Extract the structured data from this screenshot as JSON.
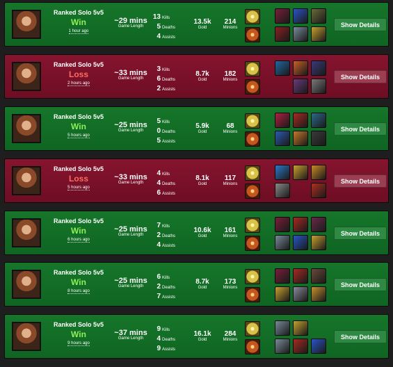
{
  "ui": {
    "kills_label": "Kills",
    "deaths_label": "Deaths",
    "assists_label": "Assists",
    "length_label": "Game Length",
    "gold_label": "Gold",
    "minions_label": "Minions",
    "button_label": "Show Details"
  },
  "matches": [
    {
      "mode": "Ranked Solo 5v5",
      "result": "Win",
      "ago": "1 hour ago",
      "length": "~29 mins",
      "kills": "13",
      "deaths": "5",
      "assists": "4",
      "gold": "13.5k",
      "minions": "214",
      "champion": "champion-portrait-icon",
      "spells": [
        "flash-icon",
        "ignite-icon"
      ],
      "items": [
        [
          "#7a1e3a",
          "#2a55c8",
          "#6a6a3a"
        ],
        [
          "#8a2020",
          "#7a8a9a",
          "#c8a030"
        ]
      ]
    },
    {
      "mode": "Ranked Solo 5v5",
      "result": "Loss",
      "ago": "2 hours ago",
      "length": "~33 mins",
      "kills": "3",
      "deaths": "6",
      "assists": "2",
      "gold": "8.7k",
      "minions": "182",
      "champion": "champion-portrait-icon",
      "spells": [
        "flash-icon",
        "ignite-icon"
      ],
      "items": [
        [
          "#1f6aa0",
          "#c86028",
          "#3a3a7a"
        ],
        [
          "#000000",
          "#6a3a7a",
          "#7a7a7a"
        ]
      ]
    },
    {
      "mode": "Ranked Solo 5v5",
      "result": "Win",
      "ago": "5 hours ago",
      "length": "~25 mins",
      "kills": "5",
      "deaths": "0",
      "assists": "5",
      "gold": "5.9k",
      "minions": "68",
      "champion": "champion-portrait-icon",
      "spells": [
        "flash-icon",
        "ignite-icon"
      ],
      "items": [
        [
          "#b02040",
          "#a82a20",
          "#2a6a8a"
        ],
        [
          "#2a5ab0",
          "#c87828",
          "#3a3a3a"
        ]
      ]
    },
    {
      "mode": "Ranked Solo 5v5",
      "result": "Loss",
      "ago": "5 hours ago",
      "length": "~33 mins",
      "kills": "4",
      "deaths": "4",
      "assists": "6",
      "gold": "8.1k",
      "minions": "117",
      "champion": "champion-portrait-icon",
      "spells": [
        "flash-icon",
        "ignite-icon"
      ],
      "items": [
        [
          "#2a7ac8",
          "#c8a030",
          "#c88a28"
        ],
        [
          "#8a8a8a",
          "#000000",
          "#b03020"
        ]
      ]
    },
    {
      "mode": "Ranked Solo 5v5",
      "result": "Win",
      "ago": "6 hours ago",
      "length": "~25 mins",
      "kills": "7",
      "deaths": "2",
      "assists": "4",
      "gold": "10.6k",
      "minions": "161",
      "champion": "champion-portrait-icon",
      "spells": [
        "flash-icon",
        "ignite-icon"
      ],
      "items": [
        [
          "#7a1e3a",
          "#a82a20",
          "#6a2a4a"
        ],
        [
          "#7a8a9a",
          "#2a55c8",
          "#c8a030"
        ]
      ]
    },
    {
      "mode": "Ranked Solo 5v5",
      "result": "Win",
      "ago": "8 hours ago",
      "length": "~25 mins",
      "kills": "6",
      "deaths": "2",
      "assists": "7",
      "gold": "8.7k",
      "minions": "173",
      "champion": "champion-portrait-icon",
      "spells": [
        "flash-icon",
        "ignite-icon"
      ],
      "items": [
        [
          "#7a1e3a",
          "#a82a20",
          "#6a4a3a"
        ],
        [
          "#c8a030",
          "#8a8a9a",
          "#c89030"
        ]
      ]
    },
    {
      "mode": "Ranked Solo 5v5",
      "result": "Win",
      "ago": "9 hours ago",
      "length": "~37 mins",
      "kills": "9",
      "deaths": "4",
      "assists": "9",
      "gold": "16.1k",
      "minions": "284",
      "champion": "champion-portrait-icon",
      "spells": [
        "flash-icon",
        "ignite-icon"
      ],
      "items": [
        [
          "#7a8a9a",
          "#c8a030",
          "#000000"
        ],
        [
          "#7a8a9a",
          "#a82a20",
          "#2a55c8"
        ]
      ]
    }
  ],
  "colors": {
    "win": "#8ef05a",
    "loss": "#ff6b5c",
    "flash": "#d9c24a",
    "ignite": "#c4571f"
  }
}
